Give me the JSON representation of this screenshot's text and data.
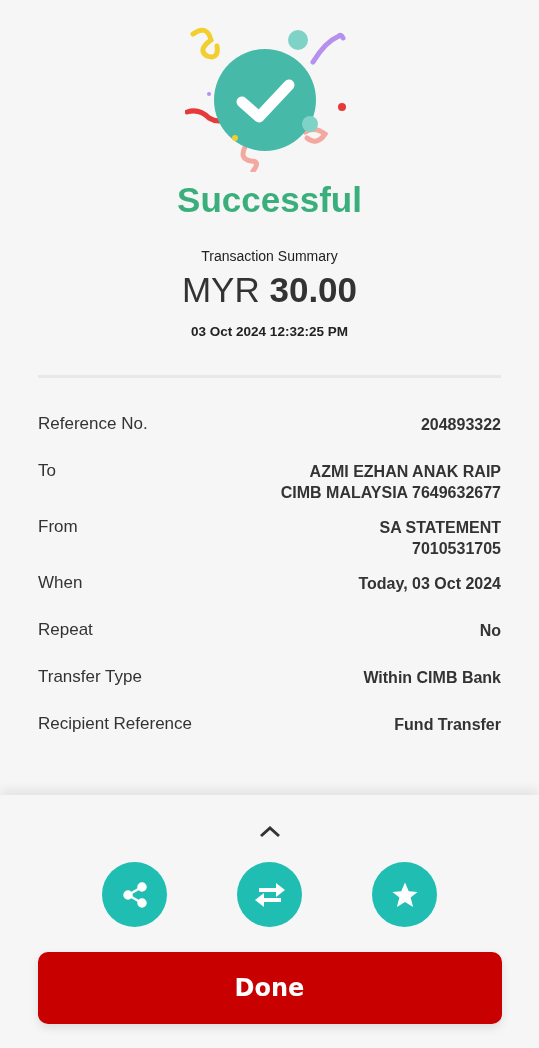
{
  "status": {
    "title": "Successful"
  },
  "summary": {
    "label": "Transaction Summary",
    "currency": "MYR",
    "amount": "30.00",
    "datetime": "03 Oct 2024 12:32:25 PM"
  },
  "details": [
    {
      "label": "Reference No.",
      "lines": [
        "204893322"
      ]
    },
    {
      "label": "To",
      "lines": [
        "AZMI EZHAN ANAK RAIP",
        "CIMB MALAYSIA 7649632677"
      ]
    },
    {
      "label": "From",
      "lines": [
        "SA STATEMENT",
        "7010531705"
      ]
    },
    {
      "label": "When",
      "lines": [
        "Today, 03 Oct 2024"
      ]
    },
    {
      "label": "Repeat",
      "lines": [
        "No"
      ]
    },
    {
      "label": "Transfer Type",
      "lines": [
        "Within CIMB Bank"
      ]
    },
    {
      "label": "Recipient Reference",
      "lines": [
        "Fund Transfer"
      ]
    }
  ],
  "sheet": {
    "expanded": false,
    "actions": [
      {
        "kind": "share"
      },
      {
        "kind": "transfer"
      },
      {
        "kind": "favorite"
      }
    ],
    "done_button": "Done"
  }
}
